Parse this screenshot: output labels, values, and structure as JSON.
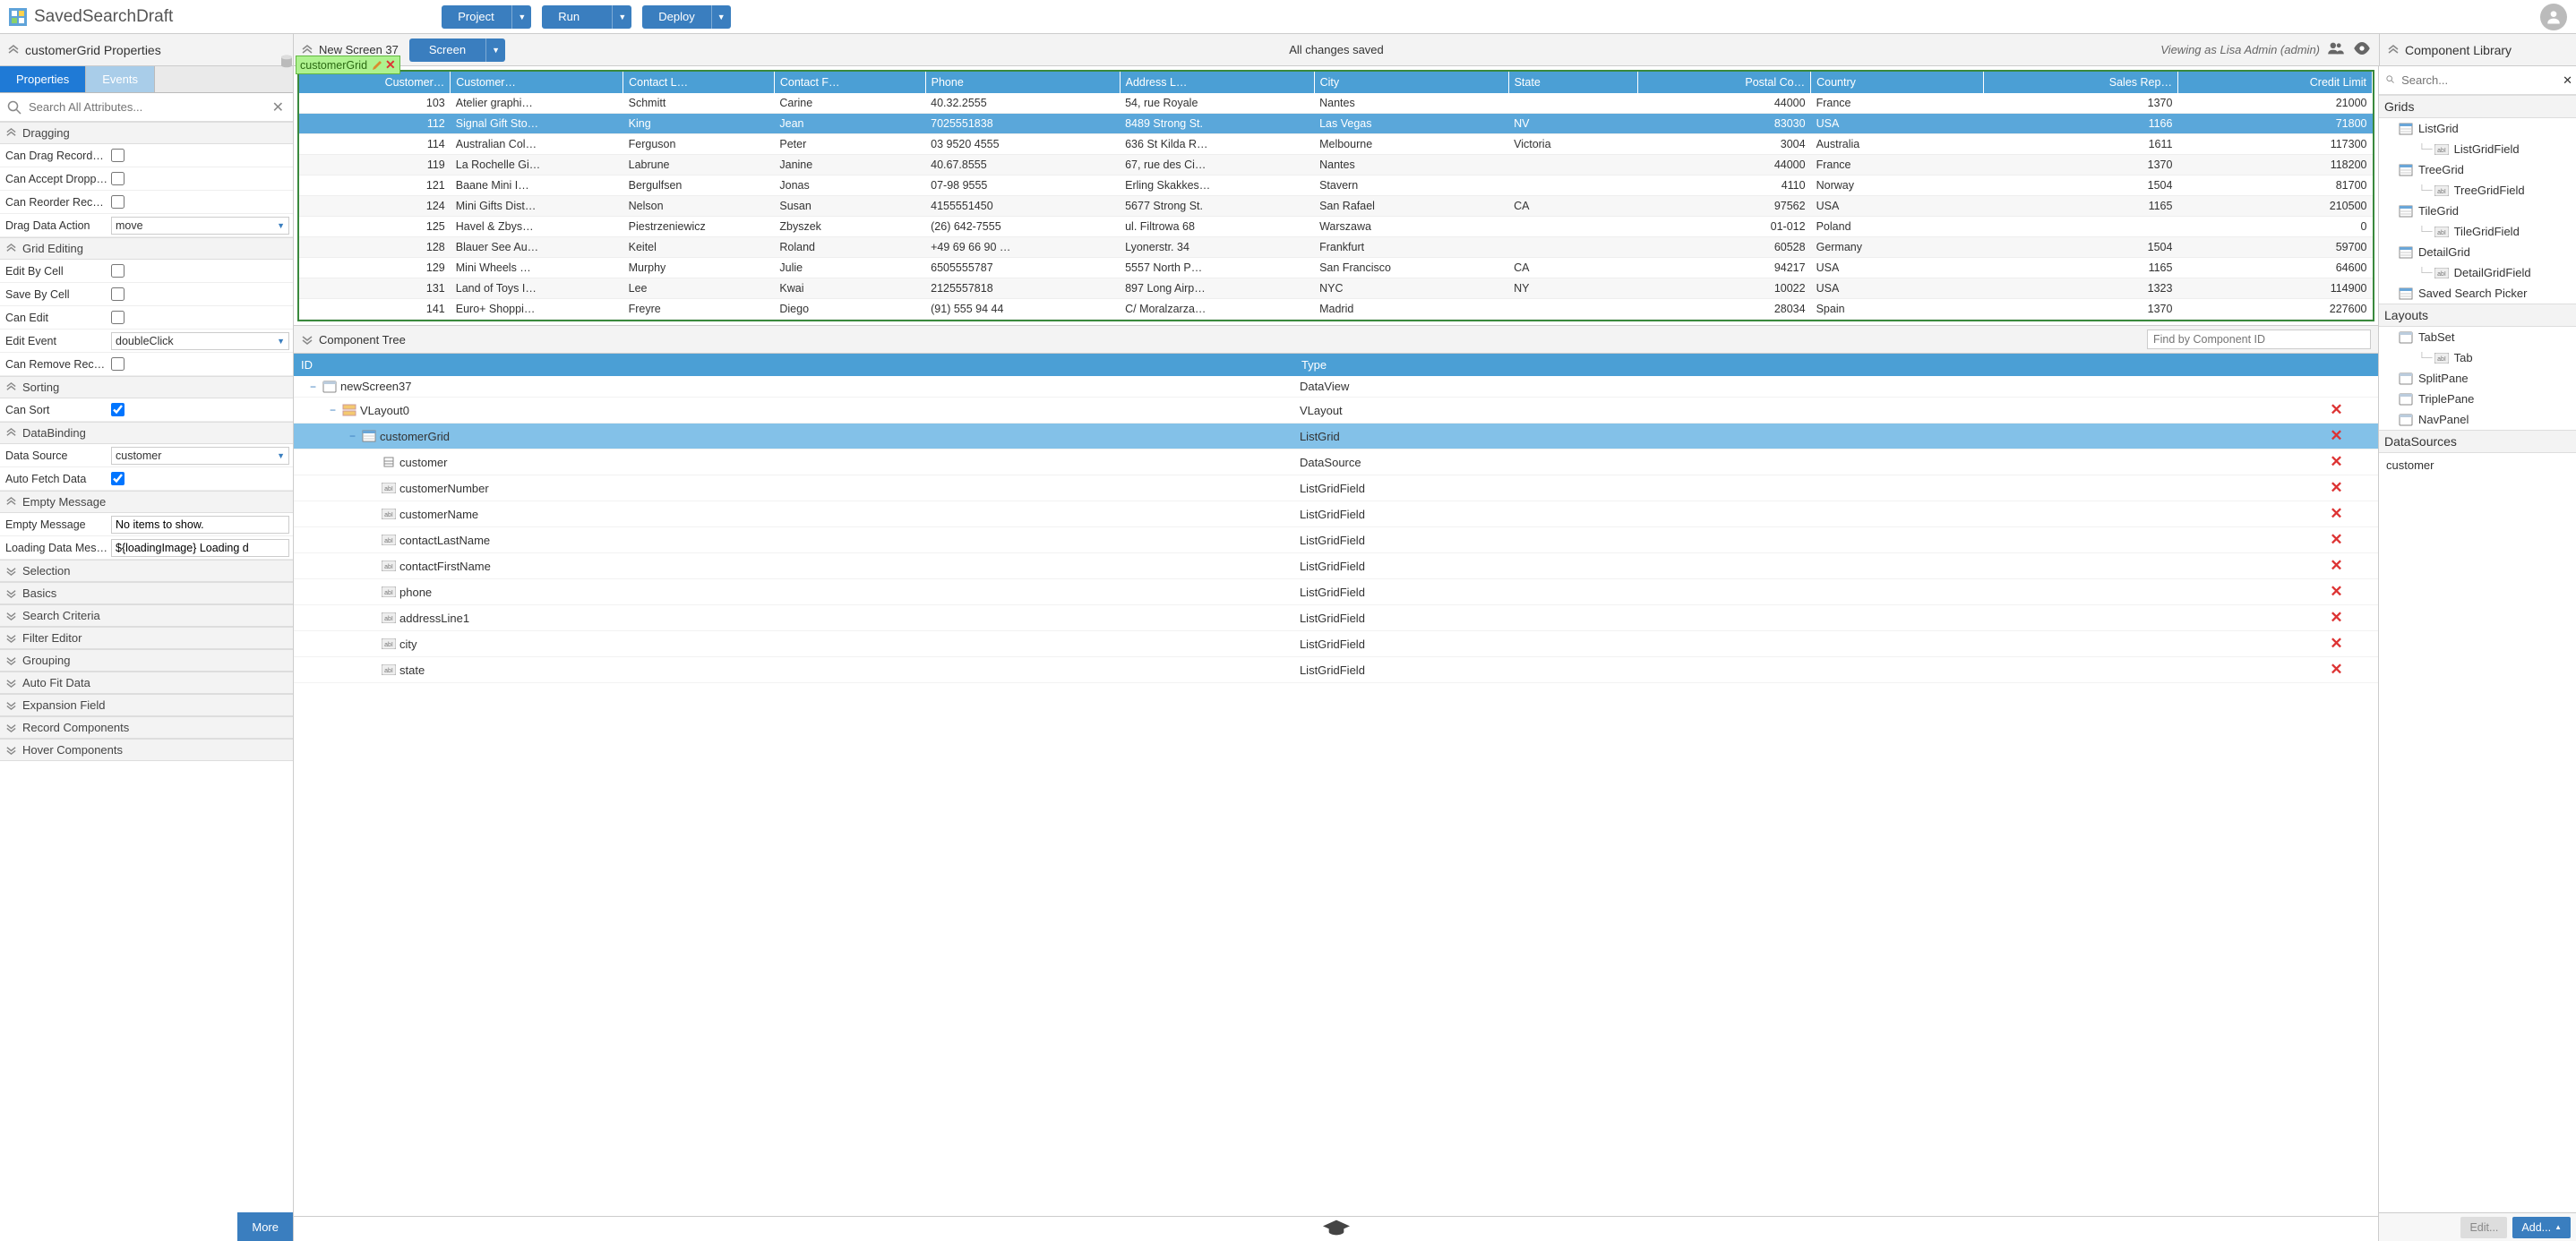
{
  "topbar": {
    "title": "SavedSearchDraft",
    "project": "Project",
    "run": "Run",
    "deploy": "Deploy"
  },
  "secondbar": {
    "left_title": "customerGrid Properties",
    "screen_name": "New Screen 37",
    "screen_button": "Screen",
    "saved": "All changes saved",
    "viewing": "Viewing as Lisa Admin (admin)",
    "right_title": "Component Library"
  },
  "left": {
    "tabs": {
      "properties": "Properties",
      "events": "Events"
    },
    "search_ph": "Search All Attributes...",
    "sections": {
      "dragging": "Dragging",
      "dragging_props": [
        {
          "name": "Can Drag Records Out",
          "type": "check",
          "value": false
        },
        {
          "name": "Can Accept Dropped ...",
          "type": "check",
          "value": false
        },
        {
          "name": "Can Reorder Records",
          "type": "check",
          "value": false
        },
        {
          "name": "Drag Data Action",
          "type": "select",
          "value": "move"
        }
      ],
      "grid_editing": "Grid Editing",
      "grid_editing_props": [
        {
          "name": "Edit By Cell",
          "type": "check",
          "value": false
        },
        {
          "name": "Save By Cell",
          "type": "check",
          "value": false
        },
        {
          "name": "Can Edit",
          "type": "check",
          "value": false
        },
        {
          "name": "Edit Event",
          "type": "select",
          "value": "doubleClick"
        },
        {
          "name": "Can Remove Records",
          "type": "check",
          "value": false
        }
      ],
      "sorting": "Sorting",
      "sorting_props": [
        {
          "name": "Can Sort",
          "type": "check",
          "value": true
        }
      ],
      "databinding": "DataBinding",
      "databinding_props": [
        {
          "name": "Data Source",
          "type": "select",
          "value": "customer"
        },
        {
          "name": "Auto Fetch Data",
          "type": "check",
          "value": true
        }
      ],
      "empty_message": "Empty Message",
      "empty_message_props": [
        {
          "name": "Empty Message",
          "type": "text",
          "value": "No items to show."
        },
        {
          "name": "Loading Data Message",
          "type": "text",
          "value": "${loadingImage}&nbsp;Loading d"
        }
      ],
      "collapsed": [
        "Selection",
        "Basics",
        "Search Criteria",
        "Filter Editor",
        "Grouping",
        "Auto Fit Data",
        "Expansion Field",
        "Record Components",
        "Hover Components"
      ]
    },
    "more": "More"
  },
  "grid_tag": "customerGrid",
  "grid": {
    "columns": [
      "Customer…",
      "Customer…",
      "Contact L…",
      "Contact F…",
      "Phone",
      "Address L…",
      "City",
      "State",
      "Postal Co…",
      "Country",
      "Sales Rep…",
      "Credit Limit"
    ],
    "rows": [
      [
        "103",
        "Atelier graphi…",
        "Schmitt",
        "Carine",
        "40.32.2555",
        "54, rue Royale",
        "Nantes",
        "",
        "44000",
        "France",
        "1370",
        "21000"
      ],
      [
        "112",
        "Signal Gift Sto…",
        "King",
        "Jean",
        "7025551838",
        "8489 Strong St.",
        "Las Vegas",
        "NV",
        "83030",
        "USA",
        "1166",
        "71800"
      ],
      [
        "114",
        "Australian Col…",
        "Ferguson",
        "Peter",
        "03 9520 4555",
        "636 St Kilda R…",
        "Melbourne",
        "Victoria",
        "3004",
        "Australia",
        "1611",
        "117300"
      ],
      [
        "119",
        "La Rochelle Gi…",
        "Labrune",
        "Janine",
        "40.67.8555",
        "67, rue des Ci…",
        "Nantes",
        "",
        "44000",
        "France",
        "1370",
        "118200"
      ],
      [
        "121",
        "Baane Mini I…",
        "Bergulfsen",
        "Jonas",
        "07-98 9555",
        "Erling Skakkes…",
        "Stavern",
        "",
        "4110",
        "Norway",
        "1504",
        "81700"
      ],
      [
        "124",
        "Mini Gifts Dist…",
        "Nelson",
        "Susan",
        "4155551450",
        "5677 Strong St.",
        "San Rafael",
        "CA",
        "97562",
        "USA",
        "1165",
        "210500"
      ],
      [
        "125",
        "Havel & Zbys…",
        "Piestrzeniewicz",
        "Zbyszek",
        "(26) 642-7555",
        "ul. Filtrowa 68",
        "Warszawa",
        "",
        "01-012",
        "Poland",
        "",
        "0"
      ],
      [
        "128",
        "Blauer See Au…",
        "Keitel",
        "Roland",
        "+49 69 66 90 …",
        "Lyonerstr. 34",
        "Frankfurt",
        "",
        "60528",
        "Germany",
        "1504",
        "59700"
      ],
      [
        "129",
        "Mini Wheels …",
        "Murphy",
        "Julie",
        "6505555787",
        "5557 North P…",
        "San Francisco",
        "CA",
        "94217",
        "USA",
        "1165",
        "64600"
      ],
      [
        "131",
        "Land of Toys I…",
        "Lee",
        "Kwai",
        "2125557818",
        "897 Long Airp…",
        "NYC",
        "NY",
        "10022",
        "USA",
        "1323",
        "114900"
      ],
      [
        "141",
        "Euro+ Shoppi…",
        "Freyre",
        "Diego",
        "(91) 555 94 44",
        "C/ Moralzarza…",
        "Madrid",
        "",
        "28034",
        "Spain",
        "1370",
        "227600"
      ]
    ],
    "selected_row": 1
  },
  "tree": {
    "title": "Component Tree",
    "find_ph": "Find by Component ID",
    "cols": [
      "ID",
      "Type"
    ],
    "rows": [
      {
        "indent": 0,
        "toggle": "-",
        "icon": "page",
        "id": "newScreen37",
        "type": "DataView",
        "del": false
      },
      {
        "indent": 1,
        "toggle": "-",
        "icon": "vlayout",
        "id": "VLayout0",
        "type": "VLayout",
        "del": true
      },
      {
        "indent": 2,
        "toggle": "-",
        "icon": "grid",
        "id": "customerGrid",
        "type": "ListGrid",
        "del": true,
        "selected": true
      },
      {
        "indent": 3,
        "toggle": "",
        "icon": "ds",
        "id": "customer",
        "type": "DataSource",
        "del": true
      },
      {
        "indent": 3,
        "toggle": "",
        "icon": "field",
        "id": "customerNumber",
        "type": "ListGridField",
        "del": true
      },
      {
        "indent": 3,
        "toggle": "",
        "icon": "field",
        "id": "customerName",
        "type": "ListGridField",
        "del": true
      },
      {
        "indent": 3,
        "toggle": "",
        "icon": "field",
        "id": "contactLastName",
        "type": "ListGridField",
        "del": true
      },
      {
        "indent": 3,
        "toggle": "",
        "icon": "field",
        "id": "contactFirstName",
        "type": "ListGridField",
        "del": true
      },
      {
        "indent": 3,
        "toggle": "",
        "icon": "field",
        "id": "phone",
        "type": "ListGridField",
        "del": true
      },
      {
        "indent": 3,
        "toggle": "",
        "icon": "field",
        "id": "addressLine1",
        "type": "ListGridField",
        "del": true
      },
      {
        "indent": 3,
        "toggle": "",
        "icon": "field",
        "id": "city",
        "type": "ListGridField",
        "del": true
      },
      {
        "indent": 3,
        "toggle": "",
        "icon": "field",
        "id": "state",
        "type": "ListGridField",
        "del": true
      }
    ]
  },
  "library": {
    "search_ph": "Search...",
    "grids_title": "Grids",
    "grids": [
      {
        "label": "ListGrid",
        "child": "ListGridField"
      },
      {
        "label": "TreeGrid",
        "child": "TreeGridField"
      },
      {
        "label": "TileGrid",
        "child": "TileGridField"
      },
      {
        "label": "DetailGrid",
        "child": "DetailGridField"
      },
      {
        "label": "Saved Search Picker"
      }
    ],
    "layouts_title": "Layouts",
    "layouts": [
      {
        "label": "TabSet",
        "child": "Tab"
      },
      {
        "label": "SplitPane"
      },
      {
        "label": "TriplePane"
      },
      {
        "label": "NavPanel"
      }
    ],
    "datasources_title": "DataSources",
    "datasource_item": "customer",
    "edit": "Edit...",
    "add": "Add..."
  }
}
